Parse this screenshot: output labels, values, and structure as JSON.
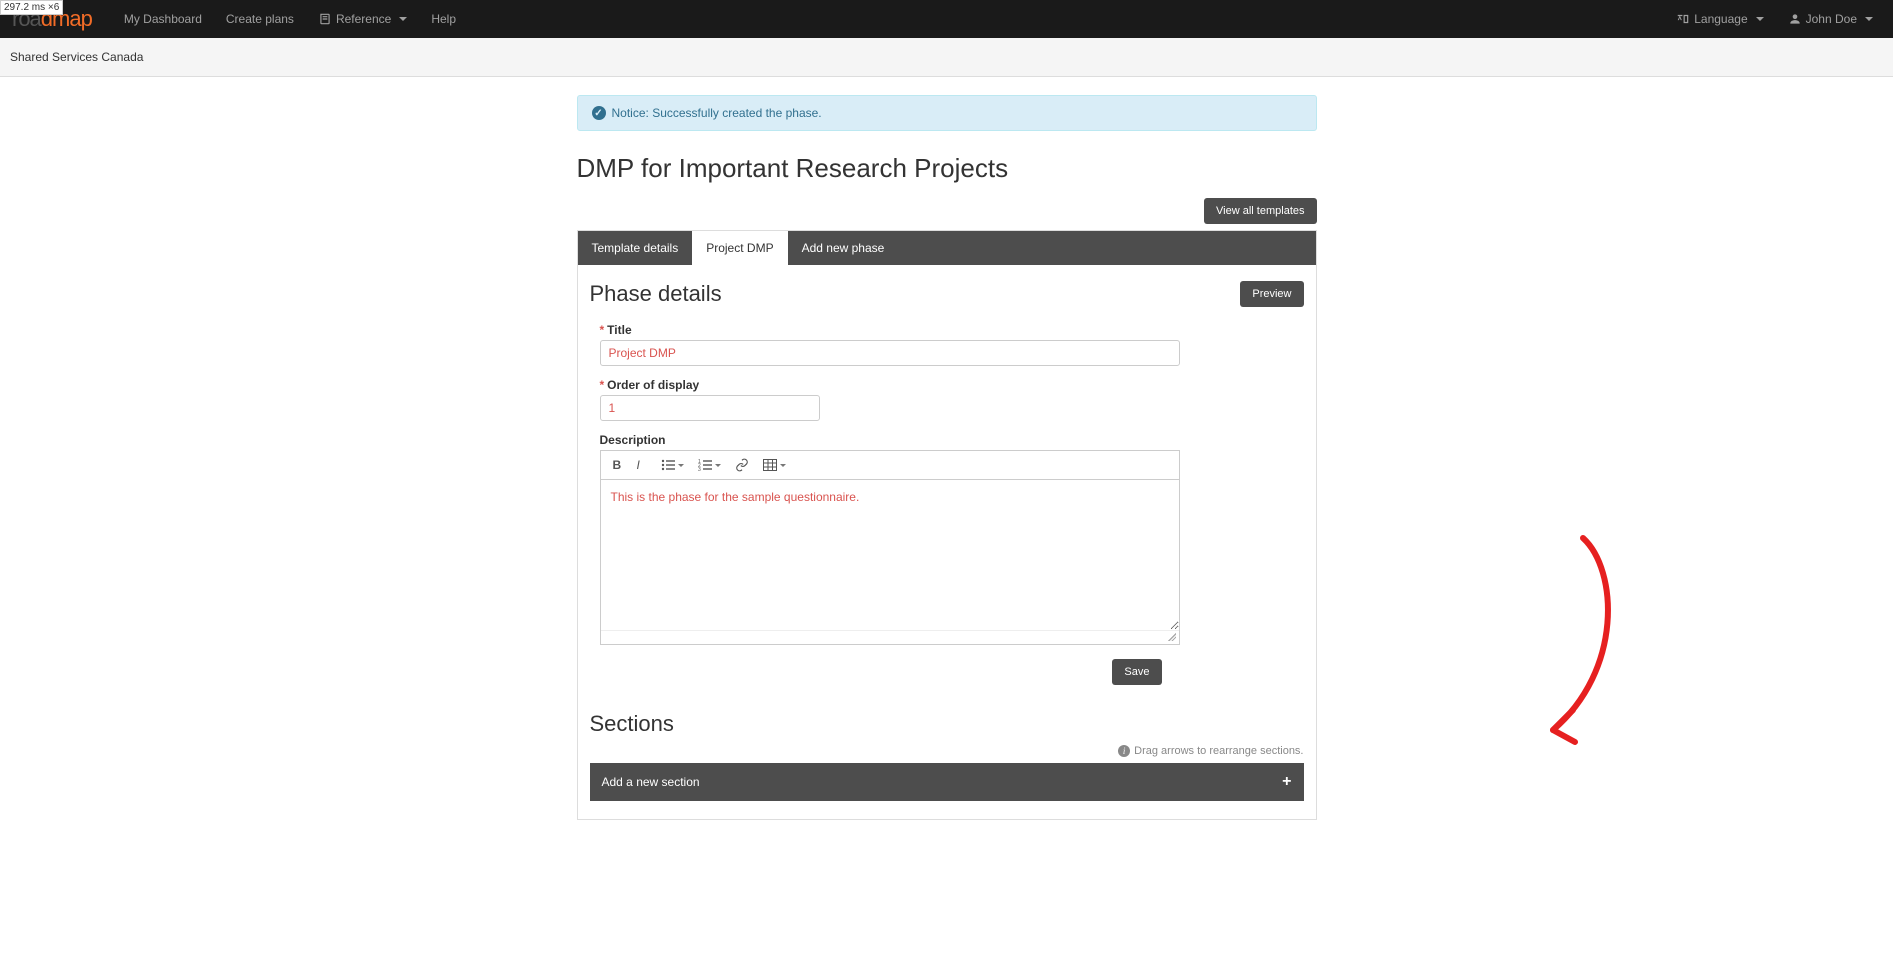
{
  "perf_badge": "297.2 ms  ×6",
  "nav": {
    "logo_roa": "roa",
    "logo_dma": "dma",
    "logo_p": "p",
    "dashboard": "My Dashboard",
    "create_plans": "Create plans",
    "reference": "Reference",
    "help": "Help",
    "language": "Language",
    "user": "John Doe"
  },
  "breadcrumb": "Shared Services Canada",
  "alert": {
    "prefix": "Notice:",
    "text": "Successfully created the phase."
  },
  "page_title": "DMP for Important Research Projects",
  "view_all_templates": "View all templates",
  "tabs": {
    "details": "Template details",
    "project": "Project DMP",
    "add_phase": "Add new phase"
  },
  "phase": {
    "heading": "Phase details",
    "preview": "Preview",
    "title_label": "Title",
    "title_value": "Project DMP",
    "order_label": "Order of display",
    "order_value": "1",
    "description_label": "Description",
    "description_text": "This is the phase for the sample questionnaire.",
    "save": "Save"
  },
  "sections": {
    "heading": "Sections",
    "hint": "Drag arrows to rearrange sections.",
    "add_new": "Add a new section"
  }
}
